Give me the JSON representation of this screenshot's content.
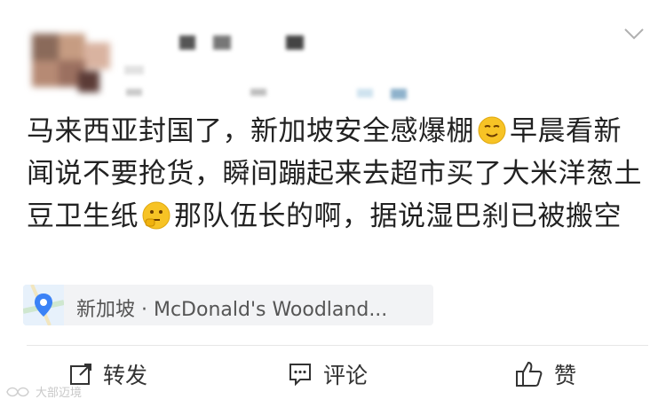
{
  "post": {
    "text_before_emoji1": "马来西亚封国了，新加坡安全感爆棚",
    "text_after_emoji1": "早晨看新闻说不要抢货，瞬间蹦起来去超市买了大米洋葱土豆卫生纸",
    "text_after_emoji2": "那队伍长的啊，据说湿巴刹已被搬空",
    "emoji1": "smirk-emoji",
    "emoji2": "thinking-emoji"
  },
  "location": {
    "label": "新加坡 · McDonald's Woodland...",
    "icon": "location-pin-icon"
  },
  "actions": {
    "repost_label": "转发",
    "comment_label": "评论",
    "like_label": "赞"
  },
  "watermark": {
    "label": "大部迈境"
  },
  "colors": {
    "pin": "#3b82f6",
    "emoji": "#f7c325",
    "chip_bg": "#f2f3f5"
  }
}
